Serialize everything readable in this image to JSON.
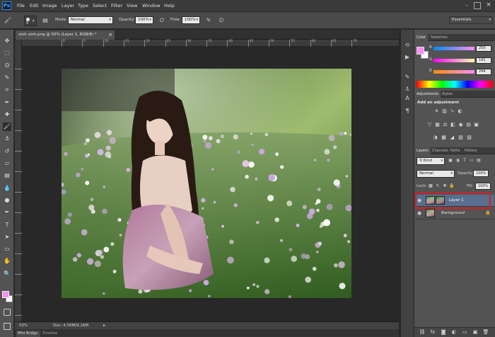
{
  "app": {
    "logo": "Ps"
  },
  "menu": [
    "File",
    "Edit",
    "Image",
    "Layer",
    "Type",
    "Select",
    "Filter",
    "View",
    "Window",
    "Help"
  ],
  "options": {
    "brush_size": "9",
    "mode_label": "Mode:",
    "mode_value": "Normal",
    "opacity_label": "Opacity:",
    "opacity_value": "100%",
    "flow_label": "Flow:",
    "flow_value": "100%",
    "workspace": "Essentials"
  },
  "document": {
    "tab_title": "xinh xinh.png @ 50% (Layer 1, RGB/8) *",
    "close": "×",
    "ruler_labels": [
      "0",
      "5",
      "10",
      "15",
      "20",
      "25",
      "30",
      "35",
      "40",
      "45",
      "50",
      "55",
      "60",
      "65",
      "70"
    ],
    "zoom": "50%",
    "doc_info": "Doc: 4.58M/9.16M"
  },
  "bottom_tabs": [
    "Mini Bridge",
    "Timeline"
  ],
  "color_panel": {
    "tabs": [
      "Color",
      "Swatches"
    ],
    "channels": [
      {
        "label": "R",
        "value": "250"
      },
      {
        "label": "G",
        "value": "141"
      },
      {
        "label": "B",
        "value": "244"
      }
    ],
    "foreground": "#fa8df4"
  },
  "adjustments_panel": {
    "tabs": [
      "Adjustments",
      "Styles"
    ],
    "heading": "Add an adjustment"
  },
  "layers_panel": {
    "tabs": [
      "Layers",
      "Channels",
      "Paths",
      "History"
    ],
    "filter_label": "Kind",
    "blend_mode": "Normal",
    "opacity_label": "Opacity:",
    "opacity_value": "100%",
    "lock_label": "Lock:",
    "fill_label": "Fill:",
    "fill_value": "100%",
    "layers": [
      {
        "name": "Layer 1",
        "selected": true
      },
      {
        "name": "Background",
        "selected": false
      }
    ]
  },
  "colors": {
    "highlight": "#d0202a",
    "selected_layer": "#5a6f8f"
  }
}
